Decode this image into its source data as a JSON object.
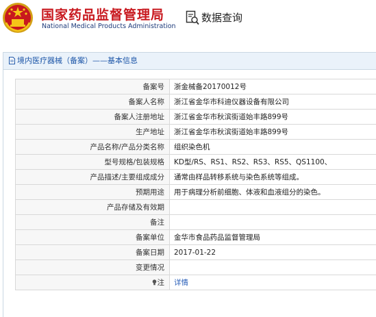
{
  "header": {
    "brand_cn": "国家药品监督管理局",
    "brand_en": "National Medical Products Administration",
    "query_label": "数据查询"
  },
  "panel": {
    "title": "境内医疗器械（备案）——基本信息"
  },
  "rows": [
    {
      "label": "备案号",
      "value": "浙金械备20170012号"
    },
    {
      "label": "备案人名称",
      "value": "浙江省金华市科迪仪器设备有限公司"
    },
    {
      "label": "备案人注册地址",
      "value": "浙江省金华市秋滨街道始丰路899号"
    },
    {
      "label": "生产地址",
      "value": "浙江省金华市秋滨街道始丰路899号"
    },
    {
      "label": "产品名称/产品分类名称",
      "value": "组织染色机"
    },
    {
      "label": "型号规格/包装规格",
      "value": "KD型/RS、RS1、RS2、RS3、RS5、QS1100、"
    },
    {
      "label": "产品描述/主要组成成分",
      "value": "通常由样品转移系统与染色系统等组成。"
    },
    {
      "label": "预期用途",
      "value": "用于病理分析前细胞、体液和血液组分的染色。"
    },
    {
      "label": "产品存储及有效期",
      "value": ""
    },
    {
      "label": "备注",
      "value": ""
    },
    {
      "label": "备案单位",
      "value": "金华市食品药品监督管理局"
    },
    {
      "label": "备案日期",
      "value": "2017-01-22"
    },
    {
      "label": "变更情况",
      "value": ""
    }
  ],
  "note_row": {
    "label": "注",
    "link_text": "详情"
  },
  "colors": {
    "brand_red": "#c8181e",
    "brand_blue": "#1d3a7a",
    "link_blue": "#2a5fb8",
    "panel_header_bg": "#eaf2fa"
  }
}
